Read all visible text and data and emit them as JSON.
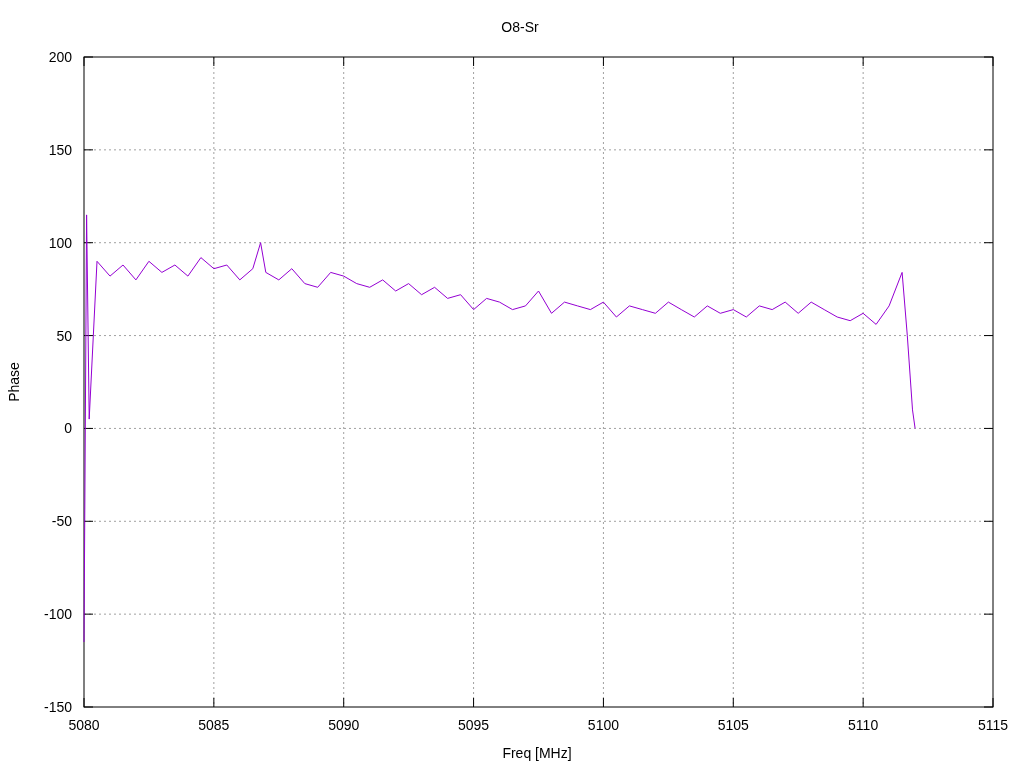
{
  "chart": {
    "chart_data": {
      "type": "line",
      "title": "O8-Sr",
      "xlabel": "Freq [MHz]",
      "ylabel": "Phase",
      "x": [
        5080,
        5080.1,
        5080.2,
        5080.5,
        5081,
        5081.5,
        5082,
        5082.5,
        5083,
        5083.5,
        5084,
        5084.5,
        5085,
        5085.5,
        5086,
        5086.5,
        5086.8,
        5087,
        5087.5,
        5088,
        5088.5,
        5089,
        5089.5,
        5090,
        5090.5,
        5091,
        5091.5,
        5092,
        5092.5,
        5093,
        5093.5,
        5094,
        5094.5,
        5095,
        5095.5,
        5096,
        5096.5,
        5097,
        5097.5,
        5098,
        5098.5,
        5099,
        5099.5,
        5100,
        5100.5,
        5101,
        5101.5,
        5102,
        5102.5,
        5103,
        5103.5,
        5104,
        5104.5,
        5105,
        5105.5,
        5106,
        5106.5,
        5107,
        5107.5,
        5108,
        5108.5,
        5109,
        5109.5,
        5110,
        5110.5,
        5111,
        5111.5,
        5111.7,
        5111.9,
        5112
      ],
      "grid": true,
      "series": [
        {
          "color": "#9400d3",
          "values": [
            -115,
            115,
            5,
            90,
            82,
            88,
            80,
            90,
            84,
            88,
            82,
            92,
            86,
            88,
            80,
            86,
            100,
            84,
            80,
            86,
            78,
            76,
            84,
            82,
            78,
            76,
            80,
            74,
            78,
            72,
            76,
            70,
            72,
            64,
            70,
            68,
            64,
            66,
            74,
            62,
            68,
            66,
            64,
            68,
            60,
            66,
            64,
            62,
            68,
            64,
            60,
            66,
            62,
            64,
            60,
            66,
            64,
            68,
            62,
            68,
            64,
            60,
            58,
            62,
            56,
            66,
            84,
            50,
            10,
            0
          ]
        }
      ],
      "xlim": [
        5080,
        5115
      ],
      "ylim": [
        -150,
        200
      ],
      "xticks": [
        5080,
        5085,
        5090,
        5095,
        5100,
        5105,
        5110,
        5115
      ],
      "yticks": [
        -150,
        -100,
        -50,
        0,
        50,
        100,
        150,
        200
      ]
    }
  }
}
